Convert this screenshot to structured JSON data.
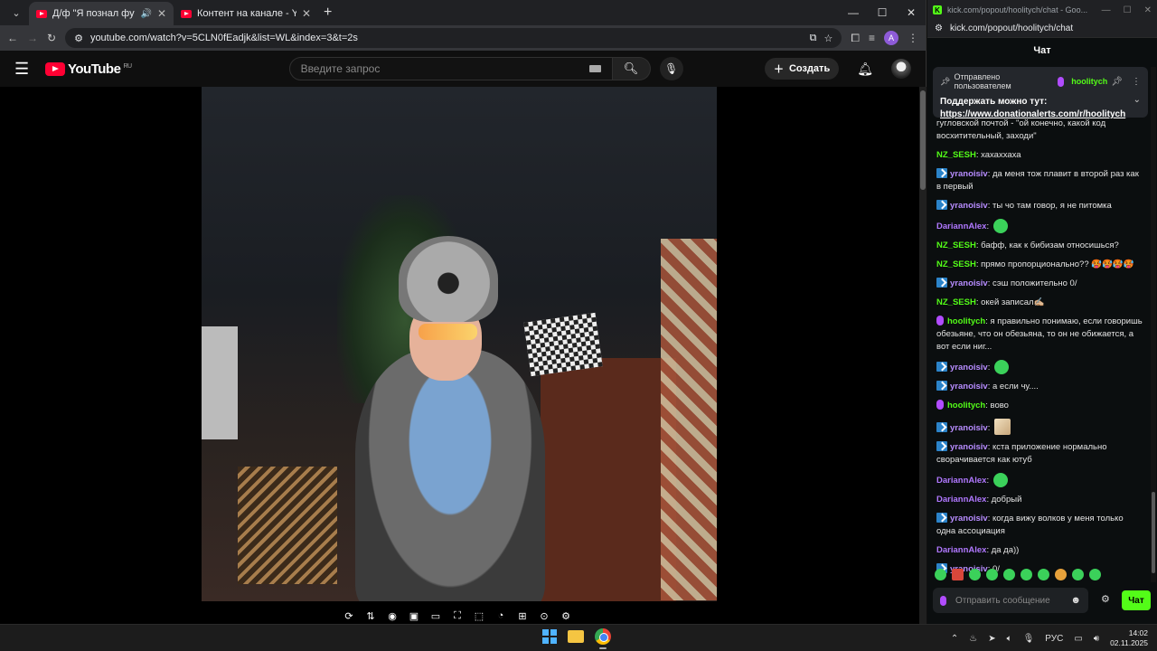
{
  "browser": {
    "tabs": [
      {
        "title": "Д/ф \"Я познал фурри, так",
        "active": true
      },
      {
        "title": "Контент на канале - YouTube",
        "active": false
      }
    ],
    "url": "youtube.com/watch?v=5CLN0fEadjk&list=WL&index=3&t=2s",
    "profile_initial": "A"
  },
  "youtube": {
    "logo_text": "YouTube",
    "region": "RU",
    "search_placeholder": "Введите запрос",
    "create_label": "Создать"
  },
  "popup": {
    "window_title": "kick.com/popout/hoolitych/chat - Goo...",
    "url": "kick.com/popout/hoolitych/chat",
    "chat_title": "Чат",
    "pinned": {
      "sent_by": "Отправлено пользователем",
      "user": "hoolitych",
      "message": "Поддержать можно тут:",
      "link": "https://www.donationalerts.com/r/hoolitych"
    },
    "messages": [
      {
        "user": "",
        "text": "гугловской почтой - \"ой конечно, какой код восхитительный, заходи\"",
        "color": "#e4e4e4",
        "badge": "none"
      },
      {
        "user": "NZ_SESH",
        "text": "хахаххаха",
        "color": "#53fc18",
        "badge": "none"
      },
      {
        "user": "yranoisiv",
        "text": "да меня тож плавит в второй раз как в первый",
        "color": "#b78cff",
        "badge": "sub"
      },
      {
        "user": "yranoisiv",
        "text": "ты чо там говор, я не питомка",
        "color": "#b78cff",
        "badge": "sub"
      },
      {
        "user": "DariannAlex",
        "text": "",
        "color": "#b078ff",
        "badge": "none",
        "emote": "green"
      },
      {
        "user": "NZ_SESH",
        "text": "бафф, как к бибизам относишься?",
        "color": "#53fc18",
        "badge": "none"
      },
      {
        "user": "NZ_SESH",
        "text": "прямо пропорционально?? 🥵🥵🥵🥵",
        "color": "#53fc18",
        "badge": "none"
      },
      {
        "user": "yranoisiv",
        "text": "сэш положительно 0/",
        "color": "#b78cff",
        "badge": "sub"
      },
      {
        "user": "NZ_SESH",
        "text": "окей записал✍🏼",
        "color": "#53fc18",
        "badge": "none"
      },
      {
        "user": "hoolitych",
        "text": "я правильно понимаю, если говоришь обезьяне, что он обезьяна, то он не обижается, а вот если ниг...",
        "color": "#53fc18",
        "badge": "mic"
      },
      {
        "user": "yranoisiv",
        "text": "",
        "color": "#b78cff",
        "badge": "sub",
        "emote": "green"
      },
      {
        "user": "yranoisiv",
        "text": "а если чу....",
        "color": "#b78cff",
        "badge": "sub"
      },
      {
        "user": "hoolitych",
        "text": "вово",
        "color": "#53fc18",
        "badge": "mic"
      },
      {
        "user": "yranoisiv",
        "text": "",
        "color": "#b78cff",
        "badge": "sub",
        "emote": "photo"
      },
      {
        "user": "yranoisiv",
        "text": "кста приложение нормально сворачивается как ютуб",
        "color": "#b78cff",
        "badge": "sub"
      },
      {
        "user": "DariannAlex",
        "text": "",
        "color": "#b078ff",
        "badge": "none",
        "emote": "green"
      },
      {
        "user": "DariannAlex",
        "text": "добрый",
        "color": "#b078ff",
        "badge": "none"
      },
      {
        "user": "yranoisiv",
        "text": "когда вижу волков у меня только одна ассоциация",
        "color": "#b78cff",
        "badge": "sub"
      },
      {
        "user": "DariannAlex",
        "text": "да да))",
        "color": "#b078ff",
        "badge": "none"
      },
      {
        "user": "yranoisiv",
        "text": "0/",
        "color": "#b78cff",
        "badge": "sub"
      }
    ],
    "input_placeholder": "Отправить сообщение",
    "send_label": "Чат"
  },
  "taskbar": {
    "lang": "РУС",
    "time": "14:02",
    "date": "02.11.2025"
  },
  "colors": {
    "kick_green": "#53fc18",
    "youtube_red": "#ff0033"
  }
}
